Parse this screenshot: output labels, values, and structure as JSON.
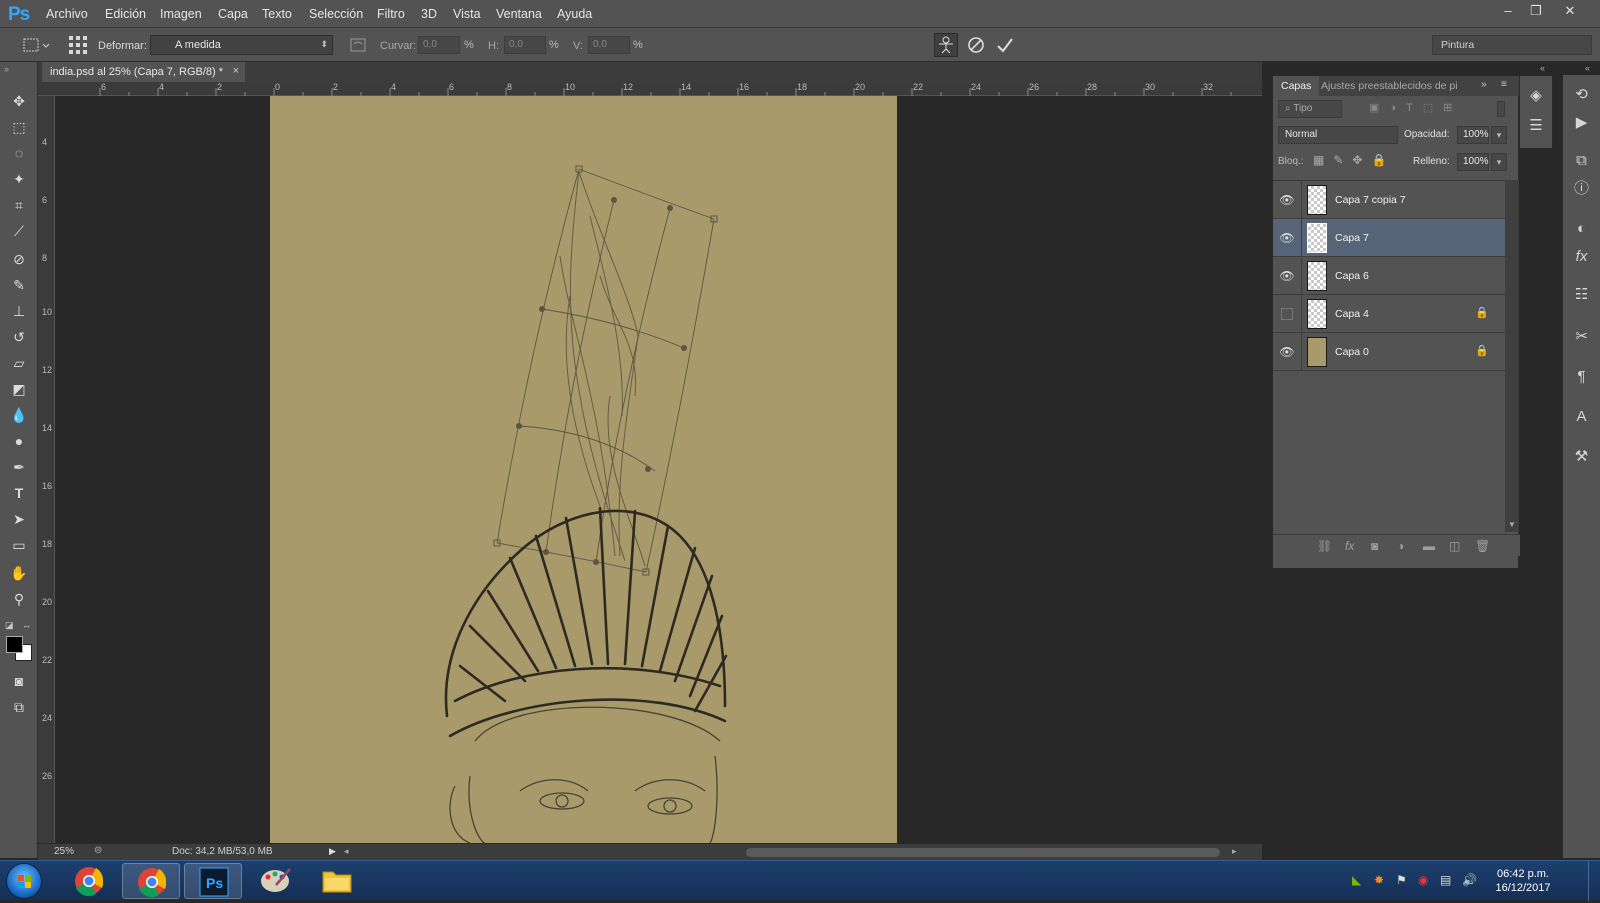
{
  "app": {
    "logo": "Ps"
  },
  "menu": [
    "Archivo",
    "Edición",
    "Imagen",
    "Capa",
    "Texto",
    "Selección",
    "Filtro",
    "3D",
    "Vista",
    "Ventana",
    "Ayuda"
  ],
  "window_controls": {
    "minimize": "–",
    "restore": "❐",
    "close": "✕"
  },
  "options": {
    "warp_label": "Deformar:",
    "warp_value": "A medida",
    "bend_label": "Curvar:",
    "bend_value": "0,0",
    "h_label": "H:",
    "h_value": "0,0",
    "v_label": "V:",
    "v_value": "0,0",
    "percent": "%",
    "workspace": "Pintura"
  },
  "document": {
    "tab_title": "india.psd al 25% (Capa 7, RGB/8) *",
    "tab_close": "×",
    "zoom": "25%",
    "doc_info": "Doc: 34,2 MB/53,0 MB",
    "ruler_h": [
      "6",
      "4",
      "2",
      "0",
      "2",
      "4",
      "6",
      "8",
      "10",
      "12",
      "14",
      "16",
      "18",
      "20",
      "22",
      "24",
      "26",
      "28",
      "30",
      "32"
    ],
    "ruler_v": [
      "4",
      "6",
      "8",
      "10",
      "12",
      "14",
      "16",
      "18",
      "20",
      "22",
      "24",
      "26"
    ]
  },
  "layers_panel": {
    "tab_active": "Capas",
    "tab_other": "Ajustes preestablecidos de pi",
    "filter": "Tipo",
    "blend_mode": "Normal",
    "opacity_label": "Opacidad:",
    "opacity": "100%",
    "lock_label": "Bloq.:",
    "fill_label": "Relleno:",
    "fill": "100%",
    "layers": [
      {
        "name": "Capa 7 copia 7",
        "visible": true,
        "locked": false,
        "selected": false,
        "thumb": "transparent"
      },
      {
        "name": "Capa 7",
        "visible": true,
        "locked": false,
        "selected": true,
        "thumb": "transparent"
      },
      {
        "name": "Capa 6",
        "visible": true,
        "locked": false,
        "selected": false,
        "thumb": "transparent"
      },
      {
        "name": "Capa 4",
        "visible": false,
        "locked": true,
        "selected": false,
        "thumb": "transparent"
      },
      {
        "name": "Capa 0",
        "visible": true,
        "locked": true,
        "selected": false,
        "thumb": "solid"
      }
    ]
  },
  "taskbar": {
    "time": "06:42 p.m.",
    "date": "16/12/2017",
    "apps": [
      "chrome",
      "chrome-active",
      "photoshop",
      "paint",
      "file-explorer"
    ]
  },
  "colors": {
    "canvas": "#a89a6a",
    "ui_panel": "#535353",
    "selected_layer": "#576478",
    "foreground": "#000000",
    "background": "#ffffff"
  }
}
